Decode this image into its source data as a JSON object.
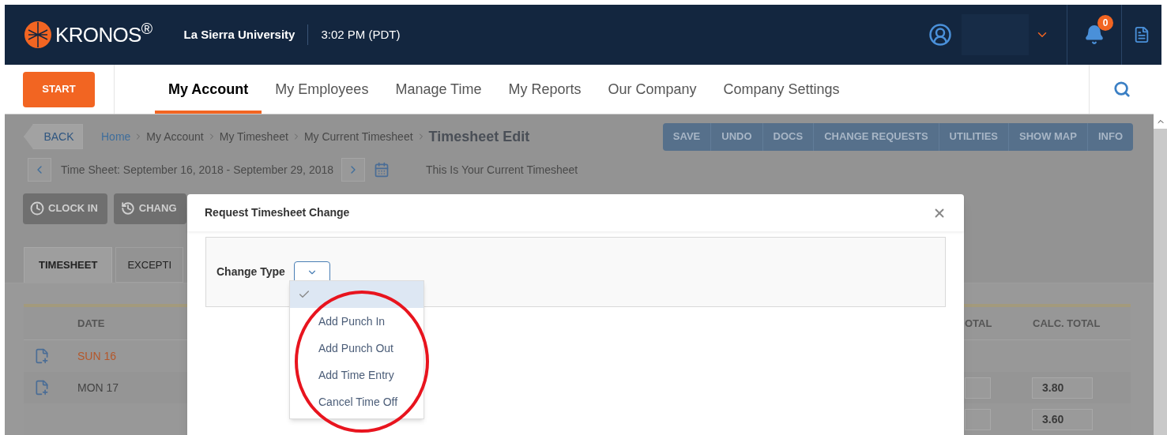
{
  "header": {
    "logo": "KRONOS$^{®}$",
    "organization": "La Sierra University",
    "time": "3:02 PM (PDT)",
    "notifications_badge": "0"
  },
  "nav": {
    "start_button": "START",
    "tabs": [
      {
        "label": "My Account",
        "selected": true
      },
      {
        "label": "My Employees",
        "selected": false
      },
      {
        "label": "Manage Time",
        "selected": false
      },
      {
        "label": "My Reports",
        "selected": false
      },
      {
        "label": "Our Company",
        "selected": false
      },
      {
        "label": "Company Settings",
        "selected": false
      }
    ]
  },
  "page": {
    "back_button": "BACK",
    "breadcrumb": [
      "Home",
      "My Account",
      "My Timesheet",
      "My Current Timesheet"
    ],
    "title": "Timesheet Edit",
    "actions": [
      "SAVE",
      "UNDO",
      "DOCS",
      "CHANGE REQUESTS",
      "UTILITIES",
      "SHOW MAP",
      "INFO"
    ],
    "period": "Time Sheet: September 16, 2018 - September 29, 2018",
    "period_note": "This Is Your Current Timesheet",
    "buttons": [
      "CLOCK IN",
      "CHANG"
    ],
    "tabs": [
      {
        "label": "TIMESHEET",
        "selected": true
      },
      {
        "label": "EXCEPTI",
        "selected": false
      }
    ]
  },
  "table": {
    "columns": [
      "DATE",
      "OTAL",
      "CALC. TOTAL"
    ],
    "rows": [
      {
        "date": "SUN 16",
        "weekend": true
      },
      {
        "date": "MON 17",
        "weekend": false,
        "calc_total": "3.80"
      },
      {
        "calc_total": "3.60"
      }
    ]
  },
  "dialog": {
    "title": "Request Timesheet Change",
    "field_label": "Change Type",
    "blank_option": {
      "selected": true
    },
    "options": [
      {
        "label": "Add Punch In",
        "selected": false
      },
      {
        "label": "Add Punch Out",
        "selected": false
      },
      {
        "label": "Add Time Entry",
        "selected": false
      },
      {
        "label": "Cancel Time Off",
        "selected": false
      }
    ]
  }
}
